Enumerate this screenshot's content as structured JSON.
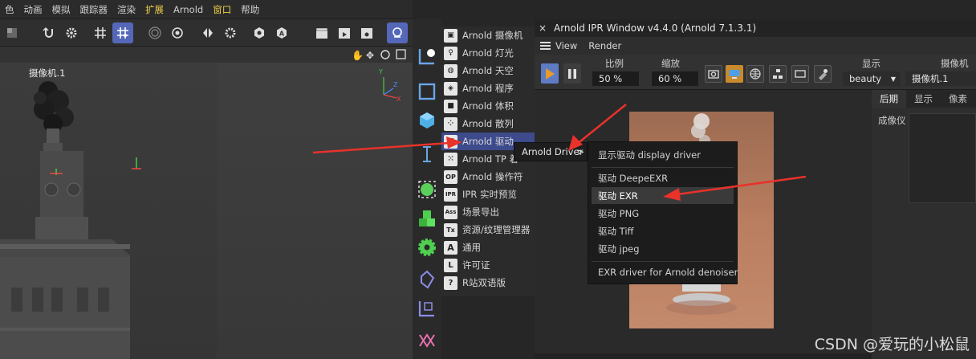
{
  "menubar": {
    "items": [
      "色",
      "动画",
      "模拟",
      "跟踪器",
      "渲染",
      "扩展",
      "Arnold",
      "窗口",
      "帮助"
    ],
    "highlighted": [
      "扩展",
      "窗口"
    ]
  },
  "viewport": {
    "camera_label": "摄像机.1"
  },
  "toolbar": {
    "icons": [
      "cube-icon",
      "undo-icon",
      "gear-icon",
      "grid-icon",
      "snap-grid-icon",
      "target-icon",
      "settings-wheel-icon",
      "symmetry-icon",
      "gear-small-icon",
      "solo-icon",
      "a-badge-icon",
      "clapper-icon",
      "play-clapper-icon",
      "gear-clapper-icon",
      "ring-icon"
    ]
  },
  "arnold_menu": {
    "items": [
      {
        "icon": "camera-icon",
        "glyph": "▣",
        "label": "Arnold 摄像机"
      },
      {
        "icon": "light-bulb-icon",
        "glyph": "♀",
        "label": "Arnold 灯光"
      },
      {
        "icon": "sky-globe-icon",
        "glyph": "◍",
        "label": "Arnold 天空"
      },
      {
        "icon": "procedural-box-icon",
        "glyph": "◈",
        "label": "Arnold 程序"
      },
      {
        "icon": "volume-cube-icon",
        "glyph": "■",
        "label": "Arnold 体积"
      },
      {
        "icon": "scatter-dots-icon",
        "glyph": "⁘",
        "label": "Arnold 散列"
      },
      {
        "icon": "driver-icon",
        "glyph": "▤",
        "label": "Arnold 驱动"
      },
      {
        "icon": "tp-dots-icon",
        "glyph": "⁙",
        "label": "Arnold TP 着"
      },
      {
        "icon": "operator-icon",
        "glyph": "OP",
        "label": "Arnold 操作符"
      },
      {
        "icon": "ipr-icon",
        "glyph": "IPR",
        "label": "IPR 实时预览"
      },
      {
        "icon": "ass-icon",
        "glyph": "Ass",
        "label": "场景导出"
      },
      {
        "icon": "tx-icon",
        "glyph": "Tx",
        "label": "资源/纹理管理器"
      },
      {
        "icon": "a-icon",
        "glyph": "A",
        "label": "通用"
      },
      {
        "icon": "license-icon",
        "glyph": "L",
        "label": "许可证"
      },
      {
        "icon": "help-icon",
        "glyph": "?",
        "label": "R站双语版"
      }
    ],
    "selected_index": 6
  },
  "submenu1": {
    "label": "Arnold Driver",
    "arrow": ">"
  },
  "submenu2": {
    "items": [
      "显示驱动 display driver",
      "驱动 DeepeEXR",
      "驱动 EXR",
      "驱动 PNG",
      "驱动 Tiff",
      "驱动 jpeg",
      "EXR driver for Arnold denoiser"
    ],
    "selected_index": 2
  },
  "ipr": {
    "close": "×",
    "title": "Arnold IPR Window v4.4.0 (Arnold 7.1.3.1)",
    "menus": [
      "View",
      "Render"
    ],
    "scale_label": "比例",
    "scale_value": "50 %",
    "zoom_label": "缩放",
    "zoom_value": "60 %",
    "display_label": "显示",
    "display_value": "beauty",
    "camera_label": "摄像机",
    "camera_value": "摄像机.1",
    "side_tabs": [
      "后期",
      "显示",
      "像素"
    ],
    "side_label": "成像仪"
  },
  "watermark": "CSDN @爱玩的小松鼠",
  "colors": {
    "accent_blue": "#5467b8",
    "menu_selection": "#3d4a8c",
    "annotation_red": "#e8322a",
    "play_orange": "#c9892d",
    "render_bg": "#b87a5c"
  }
}
